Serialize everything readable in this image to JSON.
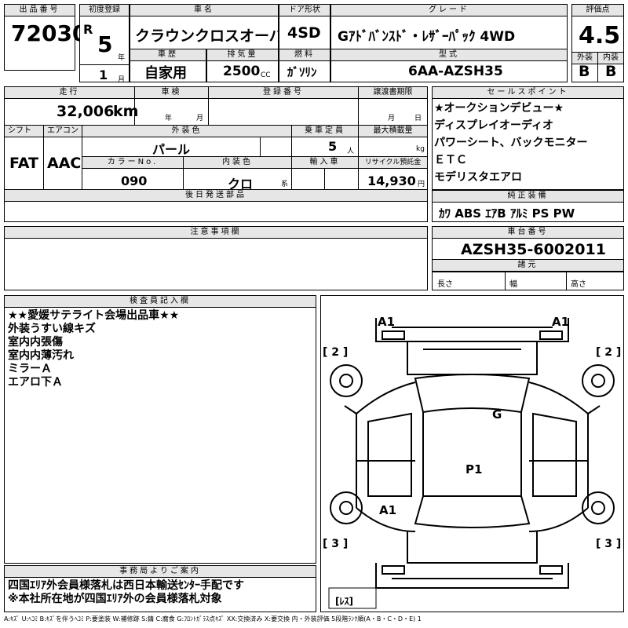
{
  "header": {
    "lot_label": "出品番号",
    "lot_number": "72030",
    "first_reg_label": "初度登録",
    "era": "R",
    "year_value": "5",
    "year_unit": "年",
    "month_value": "1",
    "month_unit": "月",
    "car_name_label": "車名",
    "car_name": "クラウンクロスオーバー",
    "door_label": "ドア形状",
    "door": "4SD",
    "grade_label": "グレード",
    "grade": "Gｱﾄﾞﾊﾞﾝｽﾄﾞ・ﾚｻﾞｰﾊﾟｯｸ 4WD",
    "score_label": "評価点",
    "score": "4.5",
    "history_label": "車歴",
    "history": "自家用",
    "displacement_label": "排気量",
    "displacement": "2500",
    "displacement_unit": "CC",
    "fuel_label": "燃料",
    "fuel": "ｶﾞｿﾘﾝ",
    "model_label": "型式",
    "model": "6AA-AZSH35",
    "exterior_label": "外装",
    "exterior_grade": "B",
    "interior_label": "内装",
    "interior_grade": "B"
  },
  "details": {
    "mileage_label": "走行",
    "mileage": "32,006",
    "mileage_unit": "km",
    "inspection_label": "車検",
    "insp_year_unit": "年",
    "insp_month_unit": "月",
    "reg_number_label": "登録番号",
    "transfer_label": "譲渡書期限",
    "transfer_month_unit": "月",
    "transfer_day_unit": "日",
    "shift_label": "シフト",
    "shift": "FAT",
    "ac_label": "エアコン",
    "ac": "AAC",
    "ext_color_label": "外装色",
    "ext_color": "パール",
    "capacity_label": "乗車定員",
    "capacity": "5",
    "capacity_unit": "人",
    "max_load_label": "最大積載量",
    "max_load_unit": "kg",
    "color_no_label": "カラーNo.",
    "color_no": "090",
    "int_color_label": "内装色",
    "int_color": "クロ",
    "int_color_unit": "系",
    "import_label": "輸入車",
    "recycle_label": "リサイクル預託金",
    "recycle": "14,930",
    "recycle_unit": "円",
    "later_parts_label": "後日発送部品"
  },
  "sales_points": {
    "label": "セールスポイント",
    "items": [
      "★オークションデビュー★",
      "ディスプレイオーディオ",
      "パワーシート、バックモニター",
      "ＥＴＣ",
      "モデリスタエアロ"
    ]
  },
  "equipment": {
    "label": "純正装備",
    "items": "ｶﾜ ABS ｴｱB ｱﾙﾐ PS PW"
  },
  "notes": {
    "label": "注意事項欄"
  },
  "chassis": {
    "label": "車台番号",
    "number": "AZSH35-6002011",
    "specs_label": "諸元",
    "length_label": "長さ",
    "width_label": "幅",
    "height_label": "高さ"
  },
  "inspector": {
    "label": "検査員記入欄",
    "lines": [
      "★★愛媛サテライト会場出品車★★",
      "外装うすい線キズ",
      "室内内張傷",
      "室内内薄汚れ",
      "ミラーＡ",
      "エアロ下Ａ"
    ]
  },
  "office": {
    "label": "事務局よりご案内",
    "lines": [
      "四国ｴﾘｱ外会員様落札は西日本輸送ｾﾝﾀｰ手配です",
      "※本社所在地が四国ｴﾘｱ外の会員様落札対象"
    ]
  },
  "diagram": {
    "marks": {
      "front_left": "A1",
      "front_right": "A1",
      "roof": "G",
      "cabin": "P1",
      "rear_left": "A1"
    },
    "tire_fl": "[ 2 ]",
    "tire_fr": "[ 2 ]",
    "tire_rl": "[ 3 ]",
    "tire_rr": "[ 3 ]",
    "spare": "[ﾚｽ]"
  },
  "legend": "A:ｷｽﾞ U:ﾍｺﾐ B:ｷｽﾞを伴うﾍｺﾐ P:要塗装 W:補修跡 S:錆 C:腐食 G:ﾌﾛﾝﾄｶﾞﾗｽ点ｷｽﾞ XX:交換済み X:要交換 内・外装評価 5段階ﾗﾝｸ順(A・B・C・D・E) 1"
}
